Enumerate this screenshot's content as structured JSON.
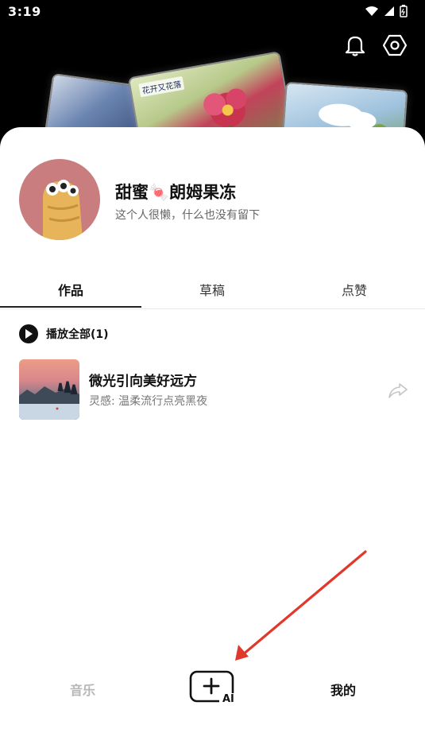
{
  "status_bar": {
    "time": "3:19"
  },
  "header_cards": {
    "middle_label": "花开又花落"
  },
  "profile": {
    "name": "甜蜜🍬朗姆果冻",
    "bio": "这个人很懒，什么也没有留下"
  },
  "tabs": [
    {
      "label": "作品",
      "active": true
    },
    {
      "label": "草稿",
      "active": false
    },
    {
      "label": "点赞",
      "active": false
    }
  ],
  "list": {
    "play_all_label": "播放全部(1)",
    "songs": [
      {
        "title": "微光引向美好远方",
        "subtitle": "灵感: 温柔流行点亮黑夜"
      }
    ]
  },
  "bottom_nav": {
    "music_label": "音乐",
    "create_label": "AI",
    "mine_label": "我的"
  },
  "colors": {
    "arrow": "#e0392b",
    "accent_dark": "#111111"
  }
}
